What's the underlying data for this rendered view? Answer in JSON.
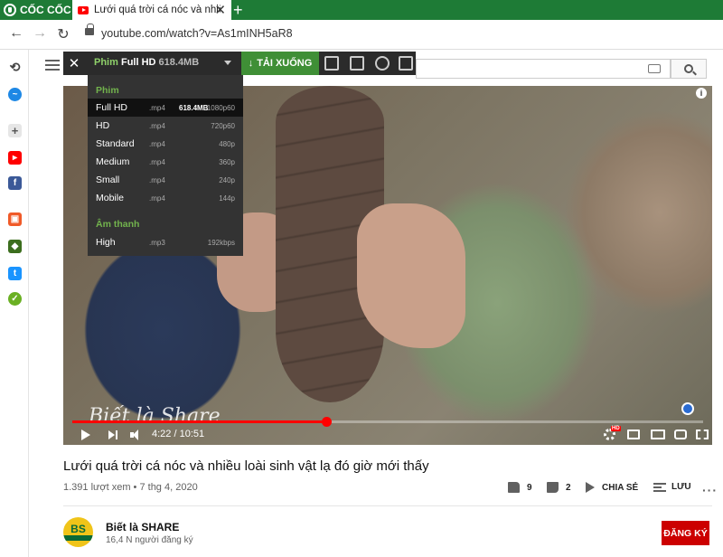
{
  "browser": {
    "name": "CỐC CỐC",
    "tab_title": "Lưới quá trời cá nóc và nhiều loài sinh vật lạ đó giờ mới thấy",
    "url": "youtube.com/watch?v=As1mINH5aR8"
  },
  "downloader": {
    "type_label": "Phim",
    "quality": "Full HD",
    "size": "618.4MB",
    "download_label": "TẢI XUỐNG",
    "section_video": "Phim",
    "section_audio": "Âm thanh",
    "video_options": [
      {
        "quality": "Full HD",
        "ext": ".mp4",
        "size": "618.4MB",
        "res": "1080p60"
      },
      {
        "quality": "HD",
        "ext": ".mp4",
        "size": "",
        "res": "720p60"
      },
      {
        "quality": "Standard",
        "ext": ".mp4",
        "size": "",
        "res": "480p"
      },
      {
        "quality": "Medium",
        "ext": ".mp4",
        "size": "",
        "res": "360p"
      },
      {
        "quality": "Small",
        "ext": ".mp4",
        "size": "",
        "res": "240p"
      },
      {
        "quality": "Mobile",
        "ext": ".mp4",
        "size": "",
        "res": "144p"
      }
    ],
    "audio_options": [
      {
        "quality": "High",
        "ext": ".mp3",
        "size": "",
        "res": "192kbps"
      }
    ]
  },
  "player": {
    "watermark": "Biết là Share",
    "current_time": "4:22",
    "duration": "10:51",
    "time_display": "4:22 / 10:51",
    "progress_fraction": 0.402
  },
  "video": {
    "title": "Lưới quá trời cá nóc và nhiều loài sinh vật lạ đó giờ mới thấy",
    "meta": "1.391 lượt xem • 7 thg 4, 2020",
    "likes": "9",
    "dislikes": "2",
    "share_label": "CHIA SẺ",
    "save_label": "LƯU"
  },
  "channel": {
    "avatar_text": "BS",
    "name": "Biết là SHARE",
    "subscribers": "16,4 N người đăng ký",
    "subscribe_label": "ĐĂNG KÝ"
  },
  "colors": {
    "browser_green": "#1e7b36",
    "download_green": "#3f8f36",
    "youtube_red": "#ff0000",
    "subscribe_red": "#cc0000"
  }
}
